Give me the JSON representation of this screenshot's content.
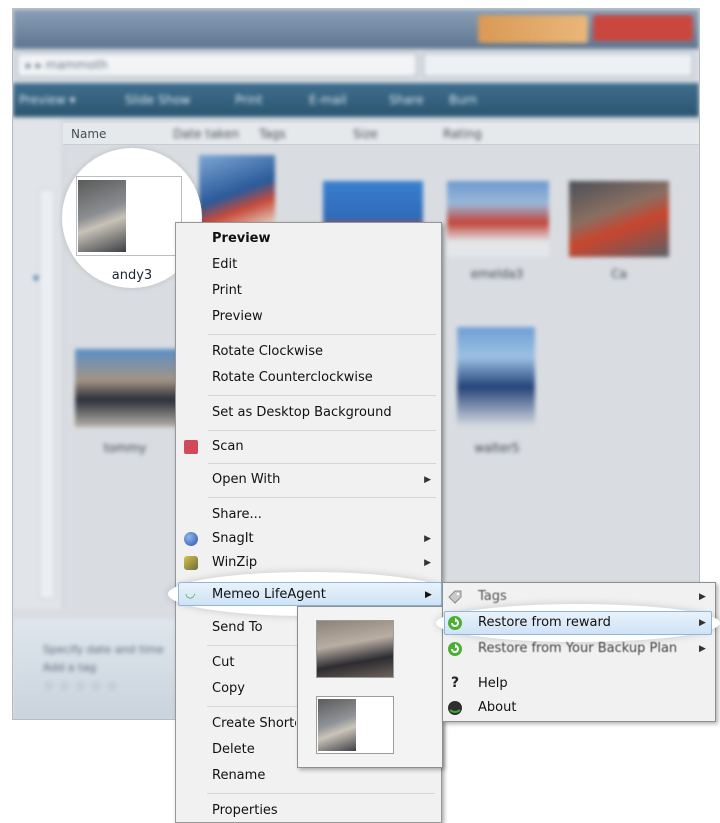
{
  "explorer": {
    "address": "▸ ▸ mammoth",
    "toolbar": [
      "Preview ▾",
      "Slide Show",
      "Print",
      "E-mail",
      "Share",
      "Burn"
    ],
    "columns": [
      "Name",
      "Date taken",
      "Tags",
      "Size",
      "Rating"
    ],
    "thumb_labels": [
      "andy3",
      "tommy",
      "walter5",
      "emelda3",
      "Ca"
    ],
    "details": [
      "Specify date and time",
      "Add a tag"
    ],
    "stars": "☆ ☆ ☆ ☆ ☆"
  },
  "selected_file": {
    "label": "andy3"
  },
  "context_menu": {
    "items": [
      {
        "label": "Preview"
      },
      {
        "label": "Edit"
      },
      {
        "label": "Print"
      },
      {
        "label": "Preview"
      },
      {
        "label": "Rotate Clockwise"
      },
      {
        "label": "Rotate Counterclockwise"
      },
      {
        "label": "Set as Desktop Background"
      },
      {
        "label": "Scan"
      },
      {
        "label": "Open With"
      },
      {
        "label": "Share..."
      },
      {
        "label": "SnagIt"
      },
      {
        "label": "WinZip"
      },
      {
        "label": "Memeo LifeAgent"
      },
      {
        "label": "Send To"
      },
      {
        "label": "Cut"
      },
      {
        "label": "Copy"
      },
      {
        "label": "Create Shortcut"
      },
      {
        "label": "Delete"
      },
      {
        "label": "Rename"
      },
      {
        "label": "Properties"
      }
    ]
  },
  "submenu": {
    "items": [
      {
        "label": "Tags",
        "icon": "tag-icon"
      },
      {
        "label": "Restore from reward",
        "icon": "restore-icon"
      },
      {
        "label": "Restore from Your Backup Plan",
        "icon": "restore-icon"
      },
      {
        "label": "Help",
        "icon": "help-icon"
      },
      {
        "label": "About",
        "icon": "about-icon"
      }
    ]
  },
  "colors": {
    "menu_bg": "#f1f1f1",
    "highlight": "#cfe3f6",
    "restore_green": "#4cae32",
    "memeo_green": "#3fa83a"
  }
}
